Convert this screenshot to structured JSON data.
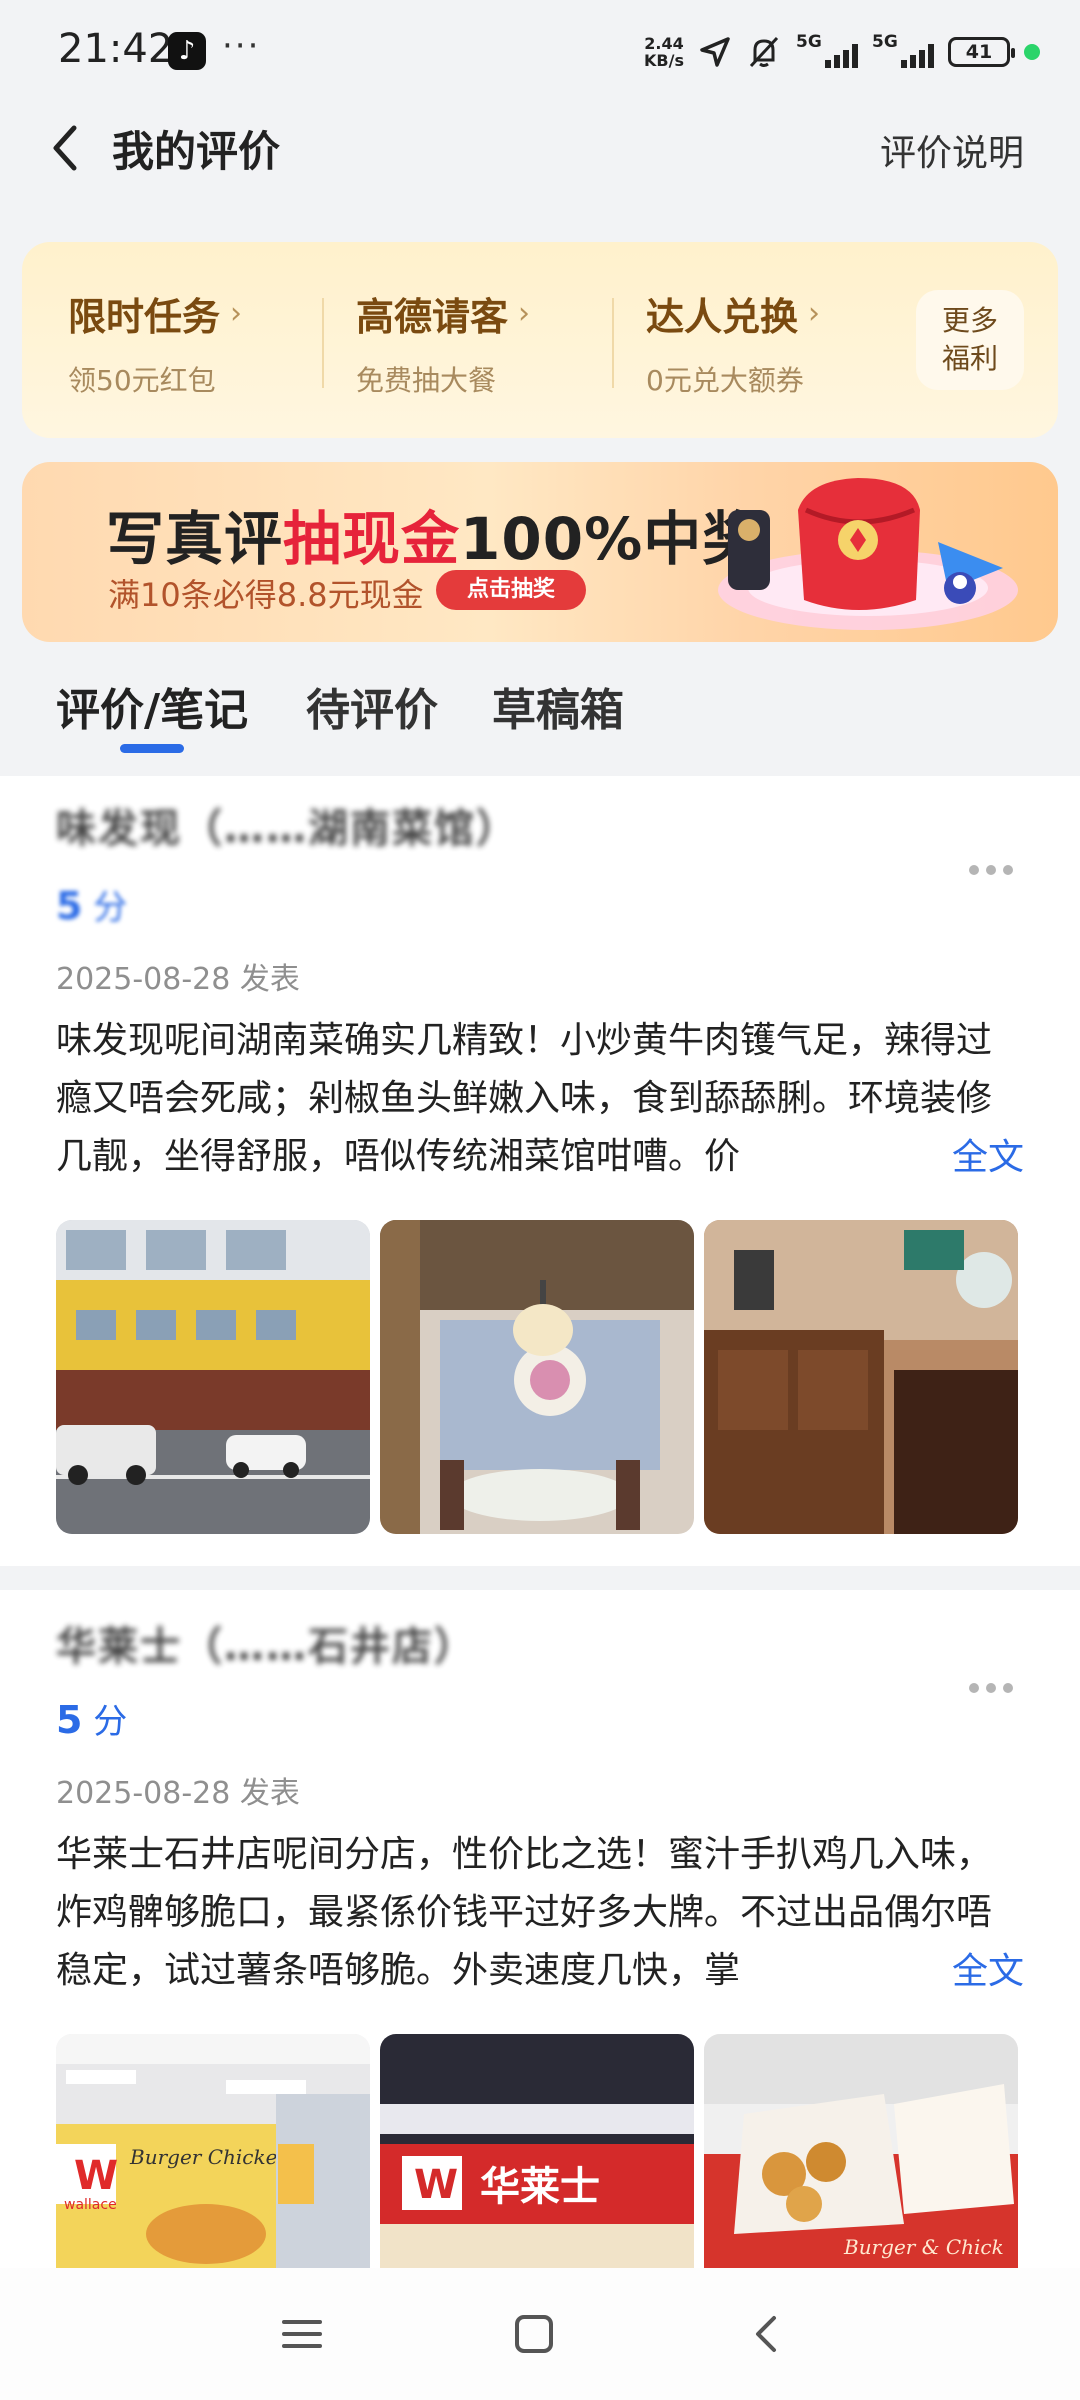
{
  "status_bar": {
    "time": "21:42",
    "app_icon": "tiktok-icon",
    "more": "···",
    "net_speed_value": "2.44",
    "net_speed_unit": "KB/s",
    "sim1": "5G",
    "sim2": "5G",
    "battery": "41"
  },
  "header": {
    "title": "我的评价",
    "explain_link": "评价说明"
  },
  "tasks": [
    {
      "title": "限时任务",
      "subtitle": "领50元红包"
    },
    {
      "title": "高德请客",
      "subtitle": "免费抽大餐"
    },
    {
      "title": "达人兑换",
      "subtitle": "0元兑大额券"
    }
  ],
  "more_welfare": {
    "line1": "更多",
    "line2": "福利"
  },
  "banner": {
    "headline_part1": "写真评",
    "headline_highlight": "抽现金",
    "headline_part2": "100%中奖",
    "subtitle": "满10条必得8.8元现金",
    "button": "点击抽奖"
  },
  "tabs": [
    "评价/笔记",
    "待评价",
    "草稿箱"
  ],
  "reviews": [
    {
      "shop": "味发现（……湖南菜馆）",
      "score": "5",
      "score_unit": "分",
      "date": "2025-08-28 发表",
      "text": "味发现呢间湖南菜确实几精致！小炒黄牛肉镬气足，辣得过瘾又唔会死咸；剁椒鱼头鲜嫩入味，食到舔舔脷。环境装修几靓，坐得舒服，唔似传统湘菜馆咁嘈。价",
      "full_link": "全文"
    },
    {
      "shop": "华莱士（……石井店）",
      "score": "5",
      "score_unit": "分",
      "date": "2025-08-28 发表",
      "text": "华莱士石井店呢间分店，性价比之选！蜜汁手扒鸡几入味，炸鸡髀够脆口，最紧係价钱平过好多大牌。不过出品偶尔唔稳定，试过薯条唔够脆。外卖速度几快，掌",
      "full_link": "全文"
    }
  ],
  "photo_text": {
    "wallace_logo": "W",
    "wallace_en": "wallace",
    "burger_chicken": "Burger Chicken",
    "store_sign": "华莱士",
    "bag_text": "Burger & Chick"
  },
  "colors": {
    "accent": "#2b6be6",
    "task_title": "#7a4a10",
    "banner_red": "#e6233a",
    "background": "#f2f3f5"
  }
}
